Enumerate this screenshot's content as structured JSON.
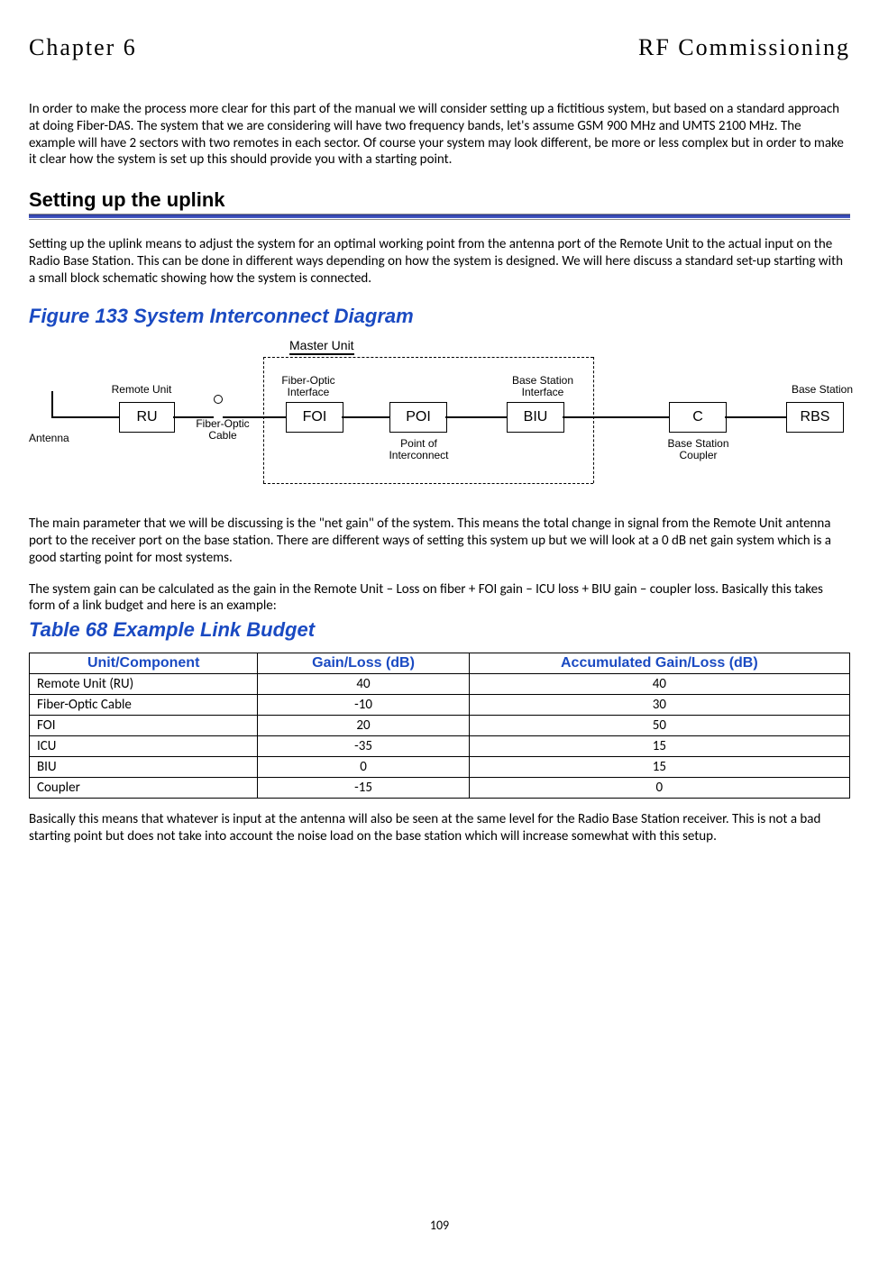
{
  "header": {
    "left": "Chapter 6",
    "right": "RF Commissioning"
  },
  "intro": "In order to make the process more clear for this part of the manual we will consider setting up a fictitious system, but based on a standard approach at doing Fiber-DAS. The system that we are considering will have two frequency bands, let's assume GSM 900 MHz and UMTS 2100 MHz. The example will have 2 sectors with two remotes in each sector. Of course your system may look different, be more or less complex but in order to make it clear how the system is set up this should provide you with a starting point.",
  "section": {
    "uplink_heading": "Setting up the uplink",
    "uplink_text": "Setting up the uplink means to adjust the system for an optimal working point from the antenna port of the Remote Unit to the actual input on the Radio Base Station. This can be done in different ways depending on how the system is designed. We will here discuss a standard set-up starting with a small block schematic showing how the system is connected."
  },
  "figure": {
    "title": "Figure 133    System Interconnect Diagram",
    "labels": {
      "master_unit": "Master Unit",
      "remote_unit": "Remote Unit",
      "fiber_optic_interface": "Fiber-Optic\nInterface",
      "base_station_interface": "Base Station\nInterface",
      "base_station": "Base Station",
      "antenna": "Antenna",
      "fiber_optic_cable": "Fiber-Optic\nCable",
      "point_of_interconnect": "Point of\nInterconnect",
      "base_station_coupler": "Base Station\nCoupler"
    },
    "boxes": {
      "ru": "RU",
      "foi": "FOI",
      "poi": "POI",
      "biu": "BIU",
      "c": "C",
      "rbs": "RBS"
    }
  },
  "after_figure_p1": "The main parameter that we will be discussing is the \"net gain\" of the system. This means the total change in signal from the Remote Unit antenna port to the receiver port on the base station. There are different ways of setting this system up but we will look at a 0 dB net gain system which is a good starting point for most systems.",
  "after_figure_p2": "The system gain can be calculated as the gain in the Remote Unit – Loss on fiber + FOI gain – ICU loss + BIU gain – coupler loss. Basically this takes form of a link budget and here is an example:",
  "table": {
    "title": "Table 68    Example Link Budget",
    "headers": [
      "Unit/Component",
      "Gain/Loss (dB)",
      "Accumulated Gain/Loss (dB)"
    ],
    "rows": [
      {
        "unit": "Remote Unit (RU)",
        "gain": "40",
        "acc": "40"
      },
      {
        "unit": "Fiber-Optic Cable",
        "gain": "-10",
        "acc": "30"
      },
      {
        "unit": "FOI",
        "gain": "20",
        "acc": "50"
      },
      {
        "unit": "ICU",
        "gain": "-35",
        "acc": "15"
      },
      {
        "unit": "BIU",
        "gain": "0",
        "acc": "15"
      },
      {
        "unit": "Coupler",
        "gain": "-15",
        "acc": "0"
      }
    ]
  },
  "closing": "Basically this means that whatever is input at the antenna will also be seen at the same level for the Radio Base Station receiver. This is not a bad starting point but does not take into account the noise load on the base station which will increase somewhat with this setup.",
  "page_number": "109"
}
